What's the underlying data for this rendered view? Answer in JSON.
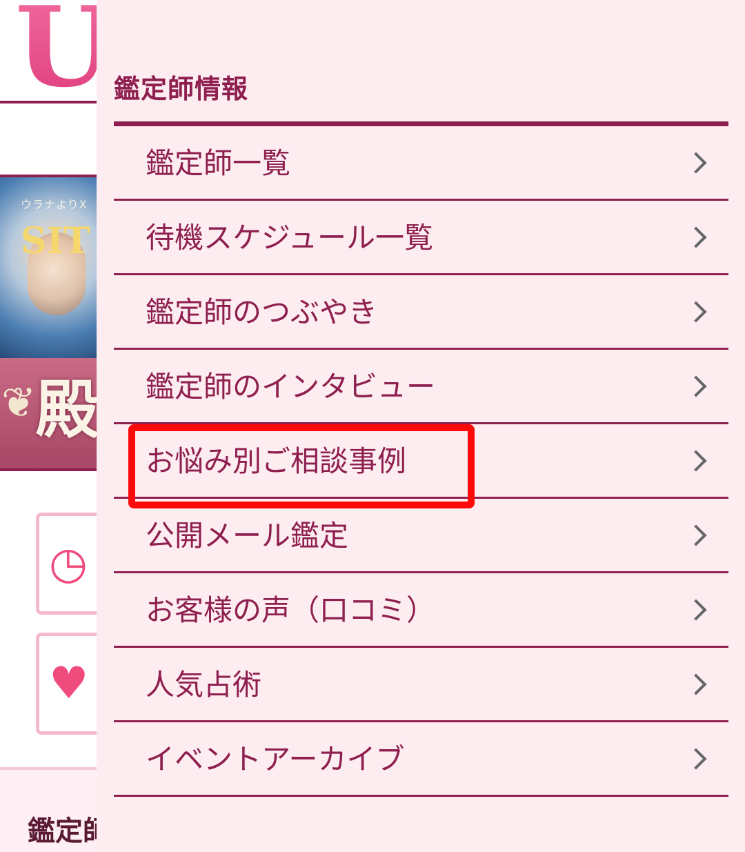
{
  "background_page": {
    "logo_letter": "U",
    "banner_subtitle": "ウラナよりX",
    "banner_badge": "SIT",
    "banner_kanji": "殿",
    "bottom_label": "鑑定師",
    "feature_icons": [
      "clock-user-icon",
      "heart-icon"
    ]
  },
  "menu": {
    "heading": "鑑定師情報",
    "items": [
      {
        "label": "鑑定師一覧"
      },
      {
        "label": "待機スケジュール一覧"
      },
      {
        "label": "鑑定師のつぶやき"
      },
      {
        "label": "鑑定師のインタビュー"
      },
      {
        "label": "お悩み別ご相談事例",
        "highlighted": true
      },
      {
        "label": "公開メール鑑定"
      },
      {
        "label": "お客様の声（口コミ）"
      },
      {
        "label": "人気占術"
      },
      {
        "label": "イベントアーカイブ"
      }
    ]
  },
  "colors": {
    "accent": "#8e1f4e",
    "menu_background": "#fdedf1",
    "highlight": "#ff0a0a",
    "logo_pink": "#f06a9c"
  }
}
